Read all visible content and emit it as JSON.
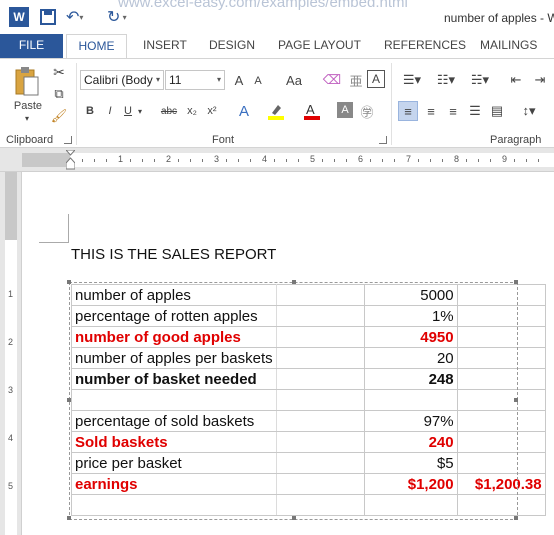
{
  "window": {
    "url_text": "www.excel-easy.com/examples/embed.html",
    "title": "number of apples - W"
  },
  "tabs": [
    "FILE",
    "HOME",
    "INSERT",
    "DESIGN",
    "PAGE LAYOUT",
    "REFERENCES",
    "MAILINGS"
  ],
  "ribbon": {
    "clipboard": {
      "label": "Clipboard",
      "paste": "Paste"
    },
    "font": {
      "label": "Font",
      "font_name": "Calibri (Body",
      "font_size": "11",
      "grow": "A",
      "shrink": "A",
      "case": "Aa",
      "bold": "B",
      "italic": "I",
      "underline": "U",
      "strike": "abc",
      "subscript": "x₂",
      "superscript": "x²"
    },
    "paragraph": {
      "label": "Paragraph"
    }
  },
  "ruler": {
    "h_numbers": [
      "1",
      "2",
      "3",
      "4",
      "5",
      "6",
      "7",
      "8",
      "9"
    ],
    "v_numbers": [
      "1",
      "2",
      "3",
      "4",
      "5"
    ]
  },
  "document": {
    "title": "THIS IS THE SALES REPORT",
    "rows": [
      {
        "style": "normal",
        "cells": [
          "number of apples",
          "",
          "5000",
          ""
        ]
      },
      {
        "style": "normal",
        "cells": [
          "percentage of rotten apples",
          "",
          "1%",
          ""
        ]
      },
      {
        "style": "red",
        "cells": [
          "number of good apples",
          "",
          "4950",
          ""
        ]
      },
      {
        "style": "normal",
        "cells": [
          "number of apples per baskets",
          "",
          "20",
          ""
        ]
      },
      {
        "style": "bold",
        "cells": [
          "number of basket needed",
          "",
          "248",
          ""
        ]
      },
      {
        "style": "normal",
        "cells": [
          "",
          "",
          "",
          ""
        ]
      },
      {
        "style": "normal",
        "cells": [
          "percentage of sold baskets",
          "",
          "97%",
          ""
        ]
      },
      {
        "style": "red",
        "cells": [
          "Sold baskets",
          "",
          "240",
          ""
        ]
      },
      {
        "style": "normal",
        "cells": [
          "price per basket",
          "",
          "$5",
          ""
        ]
      },
      {
        "style": "red",
        "cells": [
          "earnings",
          "",
          "$1,200",
          "$1,200.38"
        ]
      },
      {
        "style": "normal",
        "cells": [
          "",
          "",
          "",
          ""
        ]
      }
    ]
  },
  "colors": {
    "accent": "#2b579a",
    "highlight_red": "#e00000"
  }
}
